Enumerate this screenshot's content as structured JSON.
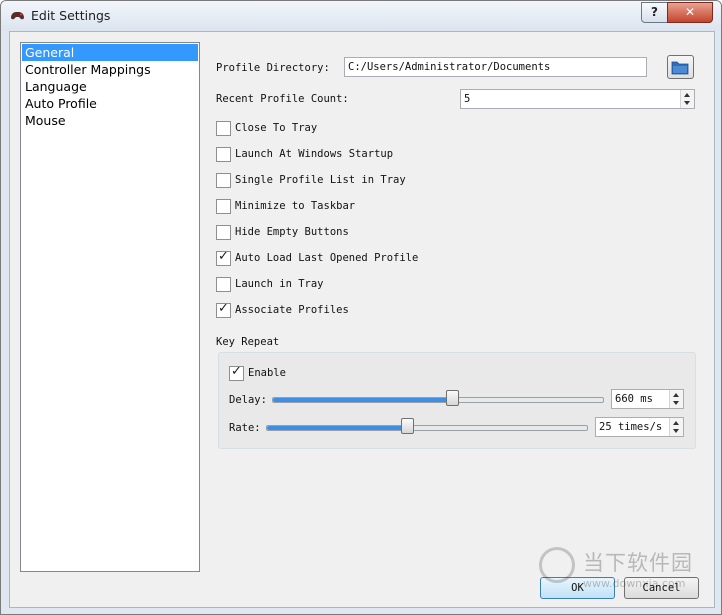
{
  "window": {
    "title": "Edit Settings",
    "help_label": "?",
    "close_label": "✕"
  },
  "pages": [
    {
      "label": "General",
      "selected": true
    },
    {
      "label": "Controller Mappings",
      "selected": false
    },
    {
      "label": "Language",
      "selected": false
    },
    {
      "label": "Auto Profile",
      "selected": false
    },
    {
      "label": "Mouse",
      "selected": false
    }
  ],
  "general": {
    "profile_directory_label": "Profile Directory:",
    "profile_directory_value": "C:/Users/Administrator/Documents",
    "browse_icon": "folder-icon",
    "recent_profile_count_label": "Recent Profile Count:",
    "recent_profile_count_value": "5",
    "options": [
      {
        "label": "Close To Tray",
        "checked": false
      },
      {
        "label": "Launch At Windows Startup",
        "checked": false
      },
      {
        "label": "Single Profile List in Tray",
        "checked": false
      },
      {
        "label": "Minimize to Taskbar",
        "checked": false
      },
      {
        "label": "Hide Empty Buttons",
        "checked": false
      },
      {
        "label": "Auto Load Last Opened Profile",
        "checked": true
      },
      {
        "label": "Launch in Tray",
        "checked": false
      },
      {
        "label": "Associate Profiles",
        "checked": true
      }
    ]
  },
  "key_repeat": {
    "title": "Key Repeat",
    "enable_label": "Enable",
    "enable_checked": true,
    "delay_label": "Delay:",
    "delay_value": "660 ms",
    "delay_fraction": 0.545,
    "rate_label": "Rate:",
    "rate_value": "25 times/s",
    "rate_fraction": 0.44
  },
  "buttons": {
    "ok_label": "OK",
    "cancel_label": "Cancel"
  },
  "watermark": {
    "cn_text": "当下软件园",
    "url_text": "www.downxia.com"
  },
  "colors": {
    "selection": "#3399ff",
    "slider_fill": "#3d8ee6",
    "close_button": "#c3452c"
  }
}
